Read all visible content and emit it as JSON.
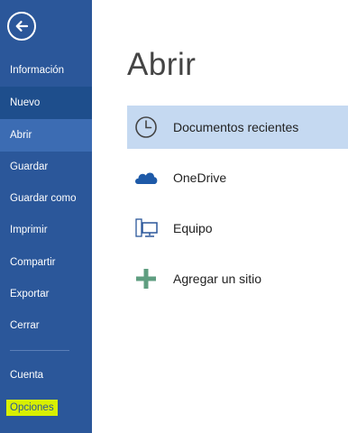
{
  "sidebar": {
    "items": [
      {
        "label": "Información"
      },
      {
        "label": "Nuevo"
      },
      {
        "label": "Abrir"
      },
      {
        "label": "Guardar"
      },
      {
        "label": "Guardar como"
      },
      {
        "label": "Imprimir"
      },
      {
        "label": "Compartir"
      },
      {
        "label": "Exportar"
      },
      {
        "label": "Cerrar"
      },
      {
        "label": "Cuenta"
      },
      {
        "label": "Opciones"
      }
    ],
    "active_item": "Abrir",
    "highlighted_item": "Opciones"
  },
  "main": {
    "title": "Abrir",
    "places": [
      {
        "label": "Documentos recientes",
        "icon": "clock-icon",
        "selected": true
      },
      {
        "label": "OneDrive",
        "icon": "cloud-icon",
        "selected": false
      },
      {
        "label": "Equipo",
        "icon": "computer-icon",
        "selected": false
      },
      {
        "label": "Agregar un sitio",
        "icon": "plus-icon",
        "selected": false
      }
    ]
  },
  "colors": {
    "sidebar": "#2b579a",
    "active": "#3c6cb3",
    "selected": "#c5d9f1",
    "highlight": "#d8f000",
    "cloud": "#1e5aa8",
    "plus": "#5f9e80"
  }
}
